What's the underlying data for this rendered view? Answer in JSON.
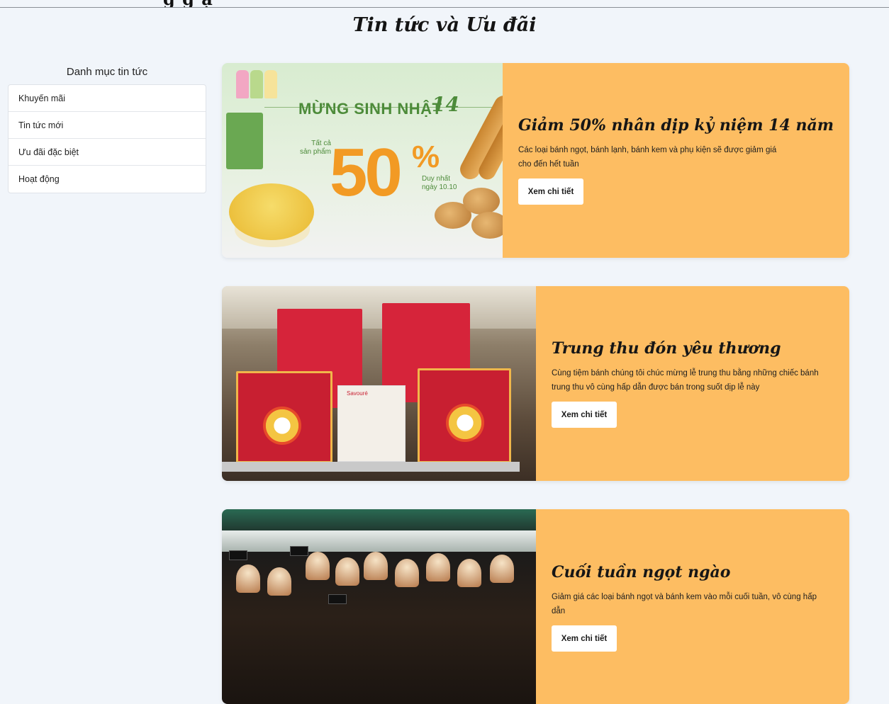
{
  "header": {
    "cut_text": "g g  ạ",
    "page_title": "Tin tức và Ưu đãi"
  },
  "sidebar": {
    "title": "Danh mục tin tức",
    "items": [
      {
        "label": "Khuyến mãi"
      },
      {
        "label": "Tin tức mới"
      },
      {
        "label": "Ưu đãi đặc biệt"
      },
      {
        "label": "Hoạt động"
      }
    ]
  },
  "cards": [
    {
      "title": "Giảm 50% nhân dịp kỷ niệm 14 năm",
      "desc": "Các loại bánh ngọt, bánh lạnh, bánh kem và phụ kiện sẽ được giảm giá cho đến hết tuần",
      "button": "Xem chi tiết",
      "image": {
        "headline": "MỪNG SINH NHẬT",
        "number": "14",
        "left_line1": "Tất cả",
        "left_line2": "sản phẩm",
        "big": "50",
        "percent": "%",
        "right_line1": "Duy nhất",
        "right_line2": "ngày 10.10"
      }
    },
    {
      "title": "Trung thu đón yêu thương",
      "desc": "Cùng tiệm bánh chúng tôi chúc mừng lễ trung thu bằng những chiếc bánh trung thu vô cùng hấp dẫn được bán trong suốt dịp lễ này",
      "button": "Xem chi tiết",
      "image": {
        "pack_label": "Savouré"
      }
    },
    {
      "title": "Cuối tuần ngọt ngào",
      "desc": "Giảm giá các loại bánh ngọt và bánh kem vào mỗi cuối tuần, vô cùng hấp dẫn",
      "button": "Xem chi tiết"
    }
  ],
  "colors": {
    "page_bg": "#f1f5fa",
    "card_body": "#fdbd62",
    "button_bg": "#ffffff"
  }
}
